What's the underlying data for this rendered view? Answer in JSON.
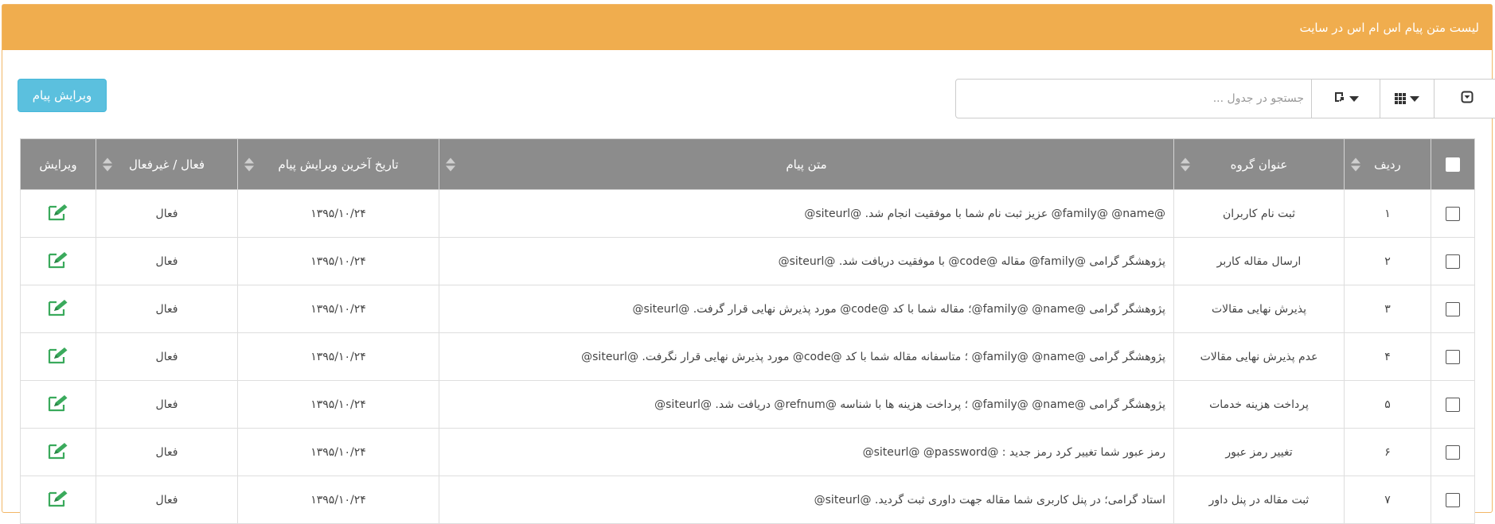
{
  "panel": {
    "title": "لیست متن پیام اس ام اس در سایت"
  },
  "toolbar": {
    "edit_button_label": "ویرایش پیام",
    "search_placeholder": "جستجو در جدول ..."
  },
  "icons": {
    "toggle": "toggle-icon",
    "columns": "grid-icon",
    "export": "export-icon",
    "edit": "edit-icon",
    "sort": "sort-icon"
  },
  "colors": {
    "header_orange": "#f0ad4e",
    "button_blue": "#5bc0de",
    "table_header_gray": "#8c8c8c",
    "edit_icon_green": "#3aaa5c"
  },
  "table": {
    "columns": {
      "row": "ردیف",
      "group": "عنوان گروه",
      "message": "متن پیام",
      "date": "تاریخ آخرین ویرایش پیام",
      "status": "فعال / غیرفعال",
      "edit": "ویرایش"
    },
    "rows": [
      {
        "row": "۱",
        "group": "ثبت نام کاربران",
        "message": "@family@ @name@ عزیز ثبت نام شما با موفقیت انجام شد. @siteurl@",
        "date": "۱۳۹۵/۱۰/۲۴",
        "status": "فعال"
      },
      {
        "row": "۲",
        "group": "ارسال مقاله کاربر",
        "message": "پژوهشگر گرامی @family@ مقاله @code@ با موفقیت دریافت شد. @siteurl@",
        "date": "۱۳۹۵/۱۰/۲۴",
        "status": "فعال"
      },
      {
        "row": "۳",
        "group": "پذیرش نهایی مقالات",
        "message": "پژوهشگر گرامی @family@ @name@؛ مقاله شما با کد @code@ مورد پذیرش نهایی قرار گرفت. @siteurl@",
        "date": "۱۳۹۵/۱۰/۲۴",
        "status": "فعال"
      },
      {
        "row": "۴",
        "group": "عدم پذیرش نهایی مقالات",
        "message": "پژوهشگر گرامی @family@ @name@ ؛ متاسفانه مقاله شما با کد @code@ مورد پذیرش نهایی قرار نگرفت. @siteurl@",
        "date": "۱۳۹۵/۱۰/۲۴",
        "status": "فعال"
      },
      {
        "row": "۵",
        "group": "پرداخت هزینه خدمات",
        "message": "پژوهشگر گرامی @family@ @name@ ؛ پرداخت هزینه ها با شناسه @refnum@ دریافت شد. @siteurl@",
        "date": "۱۳۹۵/۱۰/۲۴",
        "status": "فعال"
      },
      {
        "row": "۶",
        "group": "تغییر رمز عبور",
        "message": "رمز عبور شما تغییر کرد رمز جدید : @siteurl@ @password@",
        "date": "۱۳۹۵/۱۰/۲۴",
        "status": "فعال"
      },
      {
        "row": "۷",
        "group": "ثبت مقاله در پنل داور",
        "message": "استاد گرامی؛ در پنل کاربری شما مقاله جهت داوری ثبت گردید. @siteurl@",
        "date": "۱۳۹۵/۱۰/۲۴",
        "status": "فعال"
      }
    ]
  }
}
